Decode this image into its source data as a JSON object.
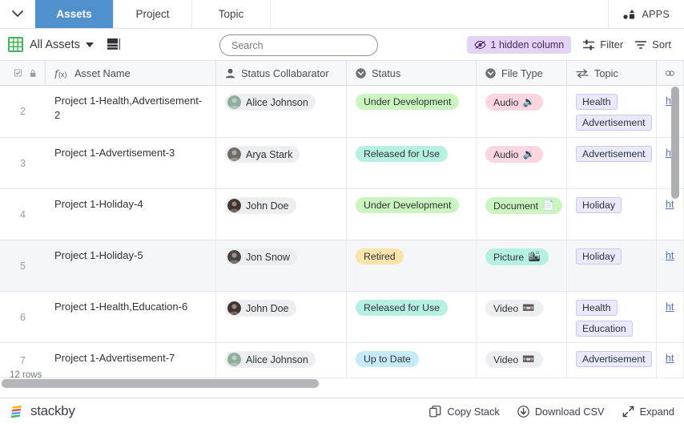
{
  "tabbar": {
    "caret_icon": "chevron-down-icon",
    "tabs": [
      {
        "label": "Assets",
        "active": true
      },
      {
        "label": "Project",
        "active": false
      },
      {
        "label": "Topic",
        "active": false
      }
    ],
    "apps_label": "APPS",
    "apps_icon": "apps-icon",
    "active_tab_color": "#5090cd"
  },
  "toolbar": {
    "grid_icon": "grid-icon",
    "view_name": "All Assets",
    "view_caret_icon": "chevron-down-icon",
    "row_height_icon": "row-height-icon",
    "search": {
      "value": "",
      "placeholder": "Search"
    },
    "hidden_column_chip": {
      "label": "1 hidden column",
      "icon": "eye-slash-icon",
      "bg_color": "#e3d4f5",
      "text_color": "#46296b"
    },
    "filter_label": "Filter",
    "filter_icon": "filter-icon",
    "sort_label": "Sort",
    "sort_icon": "sort-icon"
  },
  "table": {
    "columns": [
      {
        "key": "num",
        "label": "",
        "icons": [
          "checkbox-icon",
          "lock-icon"
        ]
      },
      {
        "key": "name",
        "label": "Asset Name",
        "icons": [
          "formula-icon"
        ]
      },
      {
        "key": "coll",
        "label": "Status Collabarator",
        "icons": [
          "person-icon"
        ]
      },
      {
        "key": "stat",
        "label": "Status",
        "icons": [
          "select-icon"
        ]
      },
      {
        "key": "file",
        "label": "File Type",
        "icons": [
          "select-icon"
        ]
      },
      {
        "key": "topic",
        "label": "Topic",
        "icons": [
          "link-record-icon"
        ]
      },
      {
        "key": "url",
        "label": "",
        "icons": [
          "link-icon"
        ]
      }
    ],
    "rows": [
      {
        "num": "2",
        "name": "Project 1-Health,Advertisement-2",
        "collaborator": "Alice Johnson",
        "avatar_color": "#8fae9b",
        "status": "Under Development",
        "status_style": "pill-green",
        "file_type": "Audio",
        "file_icon": "🔉",
        "file_style": "pill-pink",
        "topics": [
          "Health",
          "Advertisement"
        ],
        "url": "ht",
        "highlight": false
      },
      {
        "num": "3",
        "name": "Project 1-Advertisement-3",
        "collaborator": "Arya Stark",
        "avatar_color": "#6f6b66",
        "status": "Released for Use",
        "status_style": "pill-teal",
        "file_type": "Audio",
        "file_icon": "🔉",
        "file_style": "pill-pink",
        "topics": [
          "Advertisement"
        ],
        "url": "ht",
        "highlight": false
      },
      {
        "num": "4",
        "name": "Project 1-Holiday-4",
        "collaborator": "John Doe",
        "avatar_color": "#42342c",
        "status": "Under Development",
        "status_style": "pill-green",
        "file_type": "Document",
        "file_icon": "📄",
        "file_style": "pill-green",
        "topics": [
          "Holiday"
        ],
        "url": "ht",
        "highlight": false
      },
      {
        "num": "5",
        "name": "Project 1-Holiday-5",
        "collaborator": "Jon Snow",
        "avatar_color": "#4a4542",
        "status": "Retired",
        "status_style": "pill-yellow",
        "file_type": "Picture",
        "file_icon": "🏙",
        "file_style": "pill-teal",
        "topics": [
          "Holiday"
        ],
        "url": "ht",
        "highlight": true
      },
      {
        "num": "6",
        "name": "Project 1-Health,Education-6",
        "collaborator": "John Doe",
        "avatar_color": "#42342c",
        "status": "Released for Use",
        "status_style": "pill-teal",
        "file_type": "Video",
        "file_icon": "📼",
        "file_style": "pill-gray",
        "topics": [
          "Health",
          "Education"
        ],
        "url": "ht",
        "highlight": false
      },
      {
        "num": "7",
        "name": "Project 1-Advertisement-7",
        "collaborator": "Alice Johnson",
        "avatar_color": "#8fae9b",
        "status": "Up to Date",
        "status_style": "pill-blue",
        "file_type": "Video",
        "file_icon": "📼",
        "file_style": "pill-gray",
        "topics": [
          "Advertisement"
        ],
        "url": "ht",
        "highlight": false
      }
    ],
    "rows_count_label": "12 rows"
  },
  "statusbar": {
    "brand": "stackby",
    "brand_icon": "stackby-logo",
    "buttons": [
      {
        "label": "Copy Stack",
        "icon": "copy-icon"
      },
      {
        "label": "Download CSV",
        "icon": "download-icon"
      },
      {
        "label": "Expand",
        "icon": "expand-icon"
      }
    ]
  }
}
